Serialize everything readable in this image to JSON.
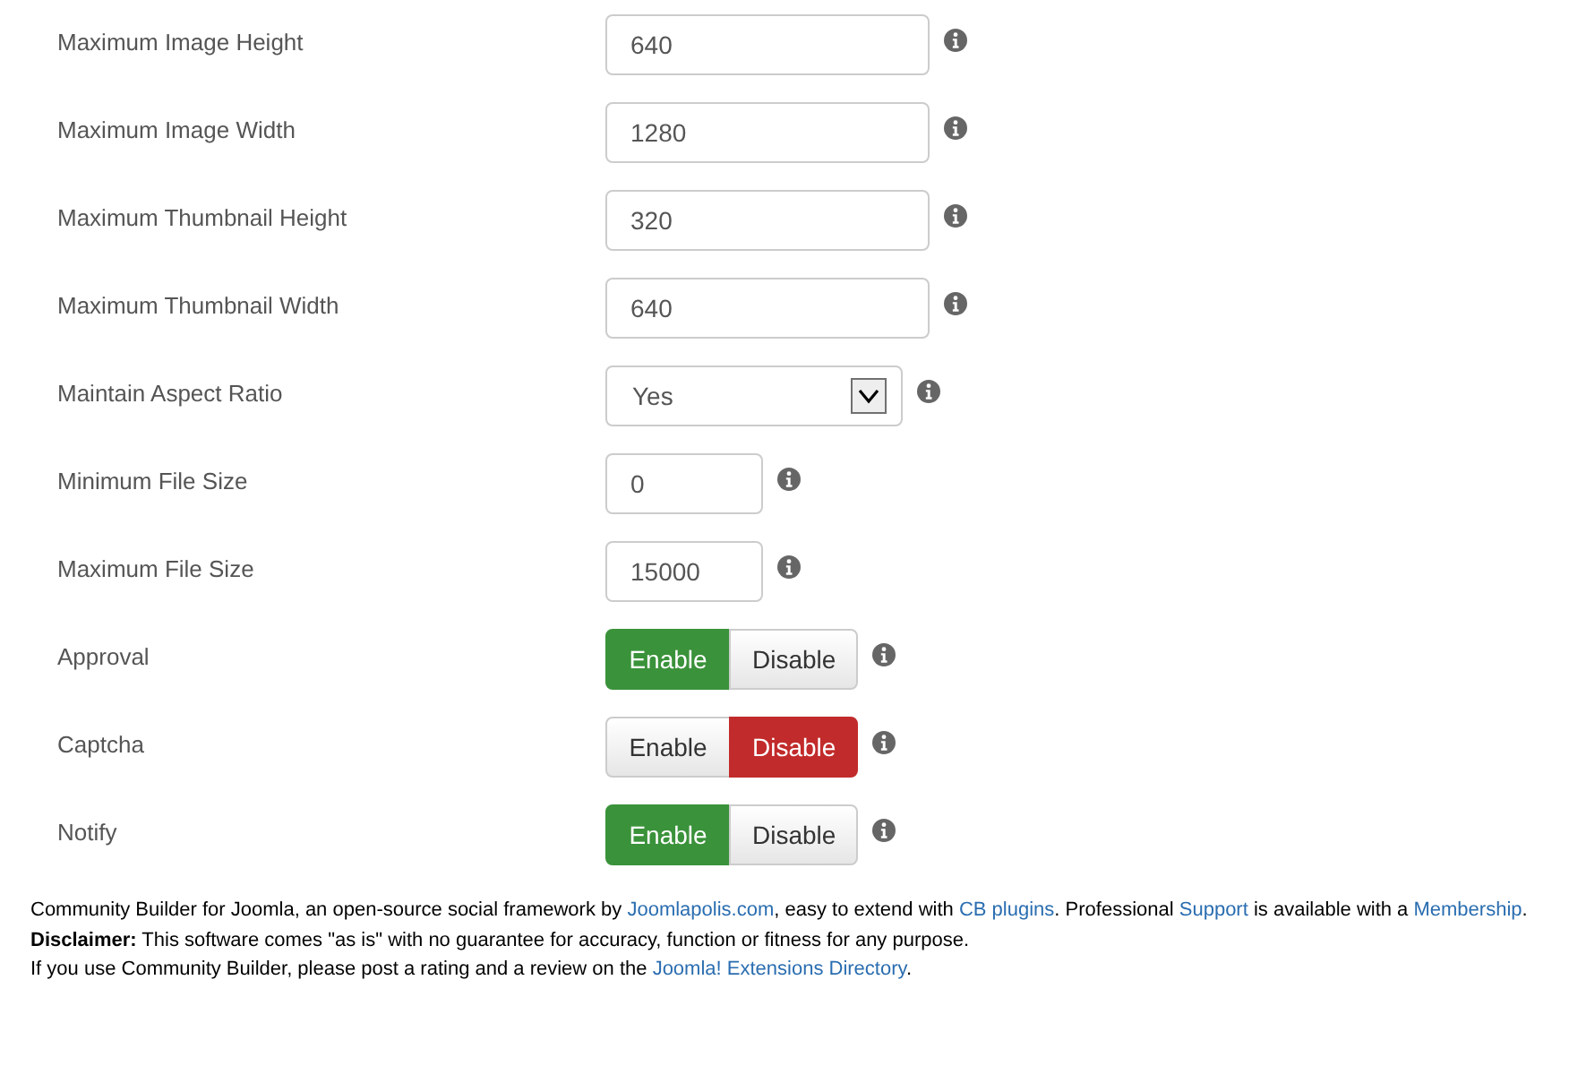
{
  "settings": [
    {
      "label": "Maximum Image Height",
      "kind": "field",
      "value": "640"
    },
    {
      "label": "Maximum Image Width",
      "kind": "field",
      "value": "1280"
    },
    {
      "label": "Maximum Thumbnail Height",
      "kind": "field",
      "value": "320"
    },
    {
      "label": "Maximum Thumbnail Width",
      "kind": "field",
      "value": "640"
    },
    {
      "label": "Maintain Aspect Ratio",
      "kind": "select",
      "value": "Yes"
    },
    {
      "label": "Minimum File Size",
      "kind": "short-field",
      "value": "0"
    },
    {
      "label": "Maximum File Size",
      "kind": "short-field",
      "value": "15000"
    },
    {
      "label": "Approval",
      "kind": "toggle",
      "options": [
        {
          "label": "Enable",
          "selected": true,
          "kind": "enable"
        },
        {
          "label": "Disable",
          "selected": false,
          "kind": "disable"
        }
      ]
    },
    {
      "label": "Captcha",
      "kind": "toggle",
      "options": [
        {
          "label": "Enable",
          "selected": false,
          "kind": "enable"
        },
        {
          "label": "Disable",
          "selected": true,
          "kind": "disable"
        }
      ]
    },
    {
      "label": "Notify",
      "kind": "toggle",
      "options": [
        {
          "label": "Enable",
          "selected": true,
          "kind": "enable"
        },
        {
          "label": "Disable",
          "selected": false,
          "kind": "disable"
        }
      ]
    }
  ],
  "footer": [
    [
      {
        "kind": "text",
        "text": "Community Builder for Joomla, an open-source social framework by "
      },
      {
        "kind": "link",
        "text": "Joomlapolis.com"
      },
      {
        "kind": "text",
        "text": ", easy to extend with "
      },
      {
        "kind": "link",
        "text": "CB plugins"
      },
      {
        "kind": "text",
        "text": ". Professional "
      },
      {
        "kind": "link",
        "text": "Support"
      },
      {
        "kind": "text",
        "text": " is available with a "
      },
      {
        "kind": "link",
        "text": "Membership"
      },
      {
        "kind": "text",
        "text": "."
      }
    ],
    [
      {
        "kind": "text",
        "text": "**Disclaimer:** This software comes \"as is\" with no guarantee for accuracy, function or fitness for any purpose."
      }
    ],
    [
      {
        "kind": "text",
        "text": "If you use Community Builder, please post a rating and a review on the "
      },
      {
        "kind": "link",
        "text": "Joomla! Extensions Directory"
      },
      {
        "kind": "text",
        "text": "."
      }
    ]
  ]
}
